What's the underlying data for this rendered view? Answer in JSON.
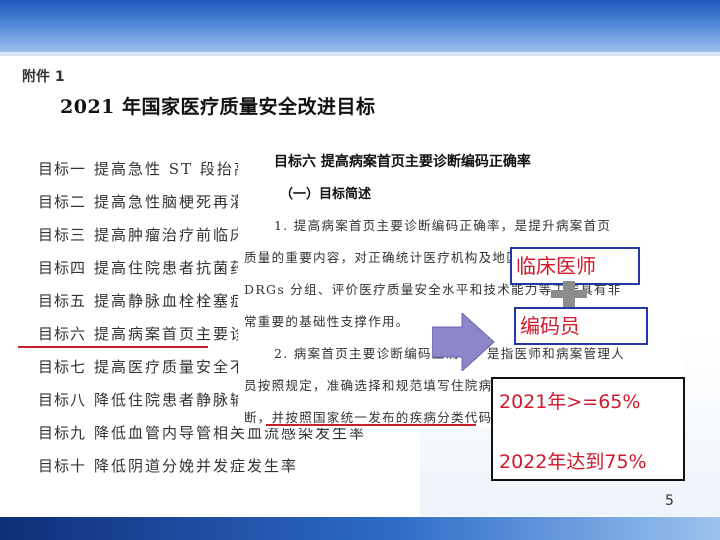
{
  "doc": {
    "tag": "附件 1",
    "title": "2021 年国家医疗质量安全改进目标",
    "goals": [
      {
        "num": "目标一",
        "text": "提高急性 ST 段抬高型心肌梗死再灌注治疗率"
      },
      {
        "num": "目标二",
        "text": "提高急性脑梗死再灌注治疗率"
      },
      {
        "num": "目标三",
        "text": "提高肿瘤治疗前临床TNM分期评估率"
      },
      {
        "num": "目标四",
        "text": "提高住院患者抗菌药物治疗前病原学送检率"
      },
      {
        "num": "目标五",
        "text": "提高静脉血栓栓塞症规范预防率"
      },
      {
        "num": "目标六",
        "text": "提高病案首页主要诊断编码正确率"
      },
      {
        "num": "目标七",
        "text": "提高医疗质量安全不良事件报告率"
      },
      {
        "num": "目标八",
        "text": "降低住院患者静脉输液使用率"
      },
      {
        "num": "目标九",
        "text": "降低血管内导管相关血流感染发生率"
      },
      {
        "num": "目标十",
        "text": "降低阴道分娩并发症发生率"
      }
    ]
  },
  "detail": {
    "heading": "目标六  提高病案首页主要诊断编码正确率",
    "subheading": "（一）目标简述",
    "lines": [
      "1. 提高病案首页主要诊断编码正确率，是提升病案首页",
      "质量的重要内容，对正确统计医疗机构及地区疾病谱、支撑",
      "DRGs 分组、评价医疗质量安全水平和技术能力等工作具有非",
      "常重要的基础性支撑作用。",
      "2. 病案首页主要诊断编码正确率，是指医师和病案管理人",
      "员按照规定，准确选择和规范填写住院病案首页中的主要诊",
      "断，并按照国家统一发布的疾病分类代码进行编码。"
    ]
  },
  "callouts": {
    "box1": "临床医师",
    "box2": "编码员",
    "target_2021": "2021年>=65%",
    "target_2022": "2022年达到75%"
  },
  "page_number": "5",
  "colors": {
    "header_blue": "#1f57b8",
    "footer_blue": "#0f2e78",
    "callout_red": "#d0192c",
    "box_border_blue": "#2237a8",
    "arrow_fill": "#8d86c9",
    "underline_red": "#c8202a"
  }
}
